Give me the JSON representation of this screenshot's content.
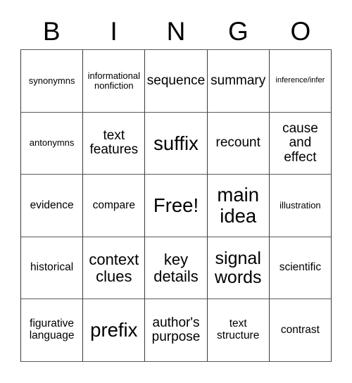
{
  "card": {
    "title": "BINGO",
    "header_letters": [
      "B",
      "I",
      "N",
      "G",
      "O"
    ],
    "rows": 5,
    "columns": 5,
    "free_space": "Free!",
    "free_space_position": {
      "row": 3,
      "column": 3
    },
    "colors": {
      "background": "#ffffff",
      "text": "#000000",
      "grid_line": "#3b3b3b",
      "grid_line_light": "#595959"
    },
    "grid": [
      [
        {
          "text": "synonymns",
          "size": "sm"
        },
        {
          "text": "informational\nnonfiction",
          "size": "sm"
        },
        {
          "text": "sequence",
          "size": "lg"
        },
        {
          "text": "summary",
          "size": "lg"
        },
        {
          "text": "inference/infer",
          "size": "xs"
        }
      ],
      [
        {
          "text": "antonymns",
          "size": "sm"
        },
        {
          "text": "text\nfeatures",
          "size": "lg"
        },
        {
          "text": "suffix",
          "size": "3xl"
        },
        {
          "text": "recount",
          "size": "lg"
        },
        {
          "text": "cause\nand\neffect",
          "size": "lg"
        }
      ],
      [
        {
          "text": "evidence",
          "size": "md"
        },
        {
          "text": "compare",
          "size": "md"
        },
        {
          "text": "Free!",
          "size": "3xl"
        },
        {
          "text": "main\nidea",
          "size": "3xl"
        },
        {
          "text": "illustration",
          "size": "sm"
        }
      ],
      [
        {
          "text": "historical",
          "size": "md"
        },
        {
          "text": "context\nclues",
          "size": "xl"
        },
        {
          "text": "key\ndetails",
          "size": "xl"
        },
        {
          "text": "signal\nwords",
          "size": "2xl"
        },
        {
          "text": "scientific",
          "size": "md"
        }
      ],
      [
        {
          "text": "figurative\nlanguage",
          "size": "md"
        },
        {
          "text": "prefix",
          "size": "3xl"
        },
        {
          "text": "author's\npurpose",
          "size": "lg"
        },
        {
          "text": "text\nstructure",
          "size": "md"
        },
        {
          "text": "contrast",
          "size": "md"
        }
      ]
    ]
  }
}
